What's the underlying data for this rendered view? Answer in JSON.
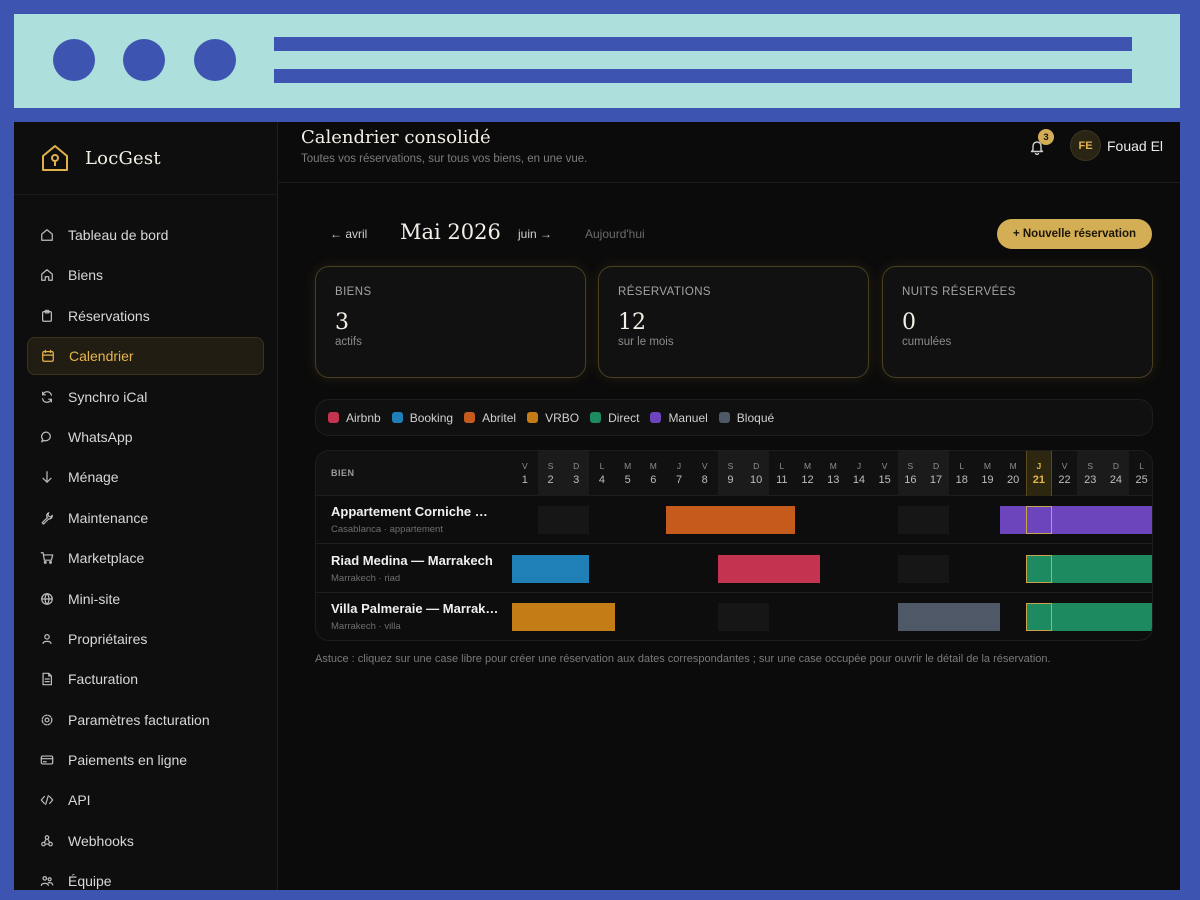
{
  "app": {
    "name": "LocGest"
  },
  "sidebar": {
    "items": [
      {
        "label": "Tableau de bord",
        "icon": "home-outline-icon"
      },
      {
        "label": "Biens",
        "icon": "house-icon"
      },
      {
        "label": "Réservations",
        "icon": "clipboard-icon"
      },
      {
        "label": "Calendrier",
        "icon": "calendar-icon"
      },
      {
        "label": "Synchro iCal",
        "icon": "sync-icon"
      },
      {
        "label": "WhatsApp",
        "icon": "chat-bubble-icon"
      },
      {
        "label": "Ménage",
        "icon": "arrow-down-icon"
      },
      {
        "label": "Maintenance",
        "icon": "wrench-icon"
      },
      {
        "label": "Marketplace",
        "icon": "cart-icon"
      },
      {
        "label": "Mini-site",
        "icon": "globe-icon"
      },
      {
        "label": "Propriétaires",
        "icon": "user-icon"
      },
      {
        "label": "Facturation",
        "icon": "document-icon"
      },
      {
        "label": "Paramètres facturation",
        "icon": "gear-icon"
      },
      {
        "label": "Paiements en ligne",
        "icon": "credit-card-icon"
      },
      {
        "label": "API",
        "icon": "code-icon"
      },
      {
        "label": "Webhooks",
        "icon": "webhook-icon"
      },
      {
        "label": "Équipe",
        "icon": "team-icon"
      }
    ],
    "active_index": 3
  },
  "header": {
    "title": "Calendrier consolidé",
    "subtitle": "Toutes vos réservations, sur tous vos biens, en une vue.",
    "notifications_count": "3",
    "user_initials": "FE",
    "user_name": "Fouad El"
  },
  "month_nav": {
    "prev": "← avril",
    "title": "Mai 2026",
    "next": "juin →",
    "today": "Aujourd'hui",
    "new_button": "+ Nouvelle réservation"
  },
  "stats": [
    {
      "label": "BIENS",
      "value": "3",
      "sub": "actifs"
    },
    {
      "label": "RÉSERVATIONS",
      "value": "12",
      "sub": "sur le mois"
    },
    {
      "label": "NUITS RÉSERVÉES",
      "value": "0",
      "sub": "cumulées"
    }
  ],
  "legend": [
    {
      "label": "Airbnb",
      "color": "#c43450"
    },
    {
      "label": "Booking",
      "color": "#1f80b8"
    },
    {
      "label": "Abritel",
      "color": "#c45a1c"
    },
    {
      "label": "VRBO",
      "color": "#c47d16"
    },
    {
      "label": "Direct",
      "color": "#1e8a60"
    },
    {
      "label": "Manuel",
      "color": "#6c44bb"
    },
    {
      "label": "Bloqué",
      "color": "#4f5866"
    }
  ],
  "calendar": {
    "property_header": "BIEN",
    "today_day": 21,
    "days": [
      {
        "l": "V",
        "n": "1"
      },
      {
        "l": "S",
        "n": "2"
      },
      {
        "l": "D",
        "n": "3"
      },
      {
        "l": "L",
        "n": "4"
      },
      {
        "l": "M",
        "n": "5"
      },
      {
        "l": "M",
        "n": "6"
      },
      {
        "l": "J",
        "n": "7"
      },
      {
        "l": "V",
        "n": "8"
      },
      {
        "l": "S",
        "n": "9"
      },
      {
        "l": "D",
        "n": "10"
      },
      {
        "l": "L",
        "n": "11"
      },
      {
        "l": "M",
        "n": "12"
      },
      {
        "l": "M",
        "n": "13"
      },
      {
        "l": "J",
        "n": "14"
      },
      {
        "l": "V",
        "n": "15"
      },
      {
        "l": "S",
        "n": "16"
      },
      {
        "l": "D",
        "n": "17"
      },
      {
        "l": "L",
        "n": "18"
      },
      {
        "l": "M",
        "n": "19"
      },
      {
        "l": "M",
        "n": "20"
      },
      {
        "l": "J",
        "n": "21"
      },
      {
        "l": "V",
        "n": "22"
      },
      {
        "l": "S",
        "n": "23"
      },
      {
        "l": "D",
        "n": "24"
      },
      {
        "l": "L",
        "n": "25"
      }
    ],
    "properties": [
      {
        "name": "Appartement Corniche …",
        "sub": "Casablanca · appartement",
        "bookings": [
          {
            "source": "Abritel",
            "start": 7,
            "end": 11
          },
          {
            "source": "Manuel",
            "start": 20,
            "end": 25
          }
        ]
      },
      {
        "name": "Riad Medina — Marrakech",
        "sub": "Marrakech · riad",
        "bookings": [
          {
            "source": "Booking",
            "start": 1,
            "end": 3
          },
          {
            "source": "Airbnb",
            "start": 9,
            "end": 12
          },
          {
            "source": "Direct",
            "start": 21,
            "end": 25
          }
        ]
      },
      {
        "name": "Villa Palmeraie — Marrak…",
        "sub": "Marrakech · villa",
        "bookings": [
          {
            "source": "VRBO",
            "start": 1,
            "end": 4
          },
          {
            "source": "Bloqué",
            "start": 16,
            "end": 19
          },
          {
            "source": "Direct",
            "start": 21,
            "end": 25
          }
        ]
      }
    ]
  },
  "tip": "Astuce : cliquez sur une case libre pour créer une réservation aux dates correspondantes ; sur une case occupée pour ouvrir le détail de la réservation."
}
